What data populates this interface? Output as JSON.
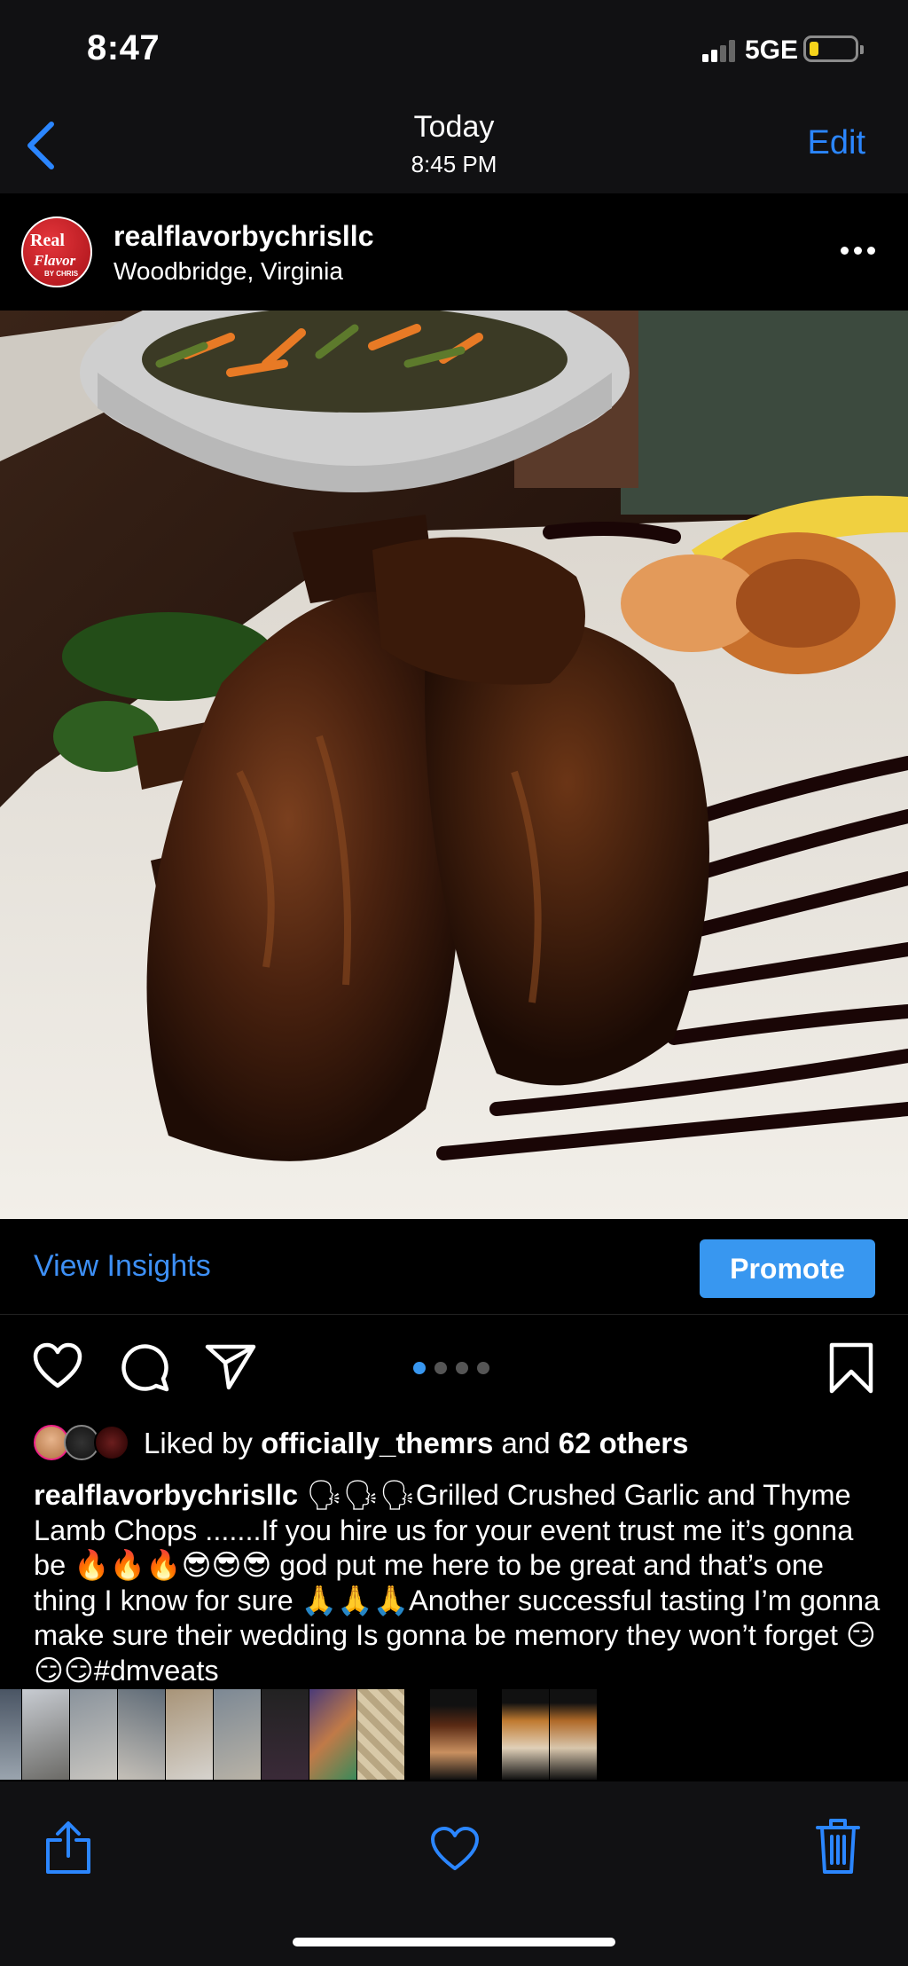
{
  "status_bar": {
    "time": "8:47",
    "network": "5GE",
    "signal_bars_active": 2,
    "battery_level": 0.15,
    "battery_color": "#f5d31b"
  },
  "nav": {
    "title": "Today",
    "subtitle": "8:45 PM",
    "edit_label": "Edit",
    "accent_color": "#2b86ff"
  },
  "post": {
    "avatar_text": [
      "Real",
      "Flavor",
      "BY CHRIS"
    ],
    "username": "realflavorbychrisllc",
    "location": "Woodbridge, Virginia",
    "more_icon": "ellipsis-icon"
  },
  "insights": {
    "view_insights_label": "View Insights",
    "promote_label": "Promote",
    "promote_color": "#3897f0"
  },
  "actions": {
    "icons": [
      "heart-icon",
      "comment-icon",
      "share-icon",
      "bookmark-icon"
    ],
    "carousel_total": 4,
    "carousel_active": 1
  },
  "likes": {
    "prefix": "Liked by",
    "user": "officially_themrs",
    "connector": "and",
    "others": "62 others"
  },
  "caption": {
    "username": "realflavorbychrisllc",
    "text": "🗣🗣🗣Grilled Crushed Garlic and Thyme Lamb Chops .......If you hire us for your event trust me it’s gonna be 🔥🔥🔥😎😎😎 god put me here to be great and that’s one thing I know for sure 🙏🙏🙏Another successful tasting I’m gonna make sure their wedding Is gonna be memory they won’t forget 😏😏😏#dmveats"
  },
  "thumbnails": {
    "count": 12
  },
  "toolbar": {
    "icons": [
      "share-icon",
      "heart-icon",
      "trash-icon"
    ],
    "icon_color": "#2b86ff"
  }
}
